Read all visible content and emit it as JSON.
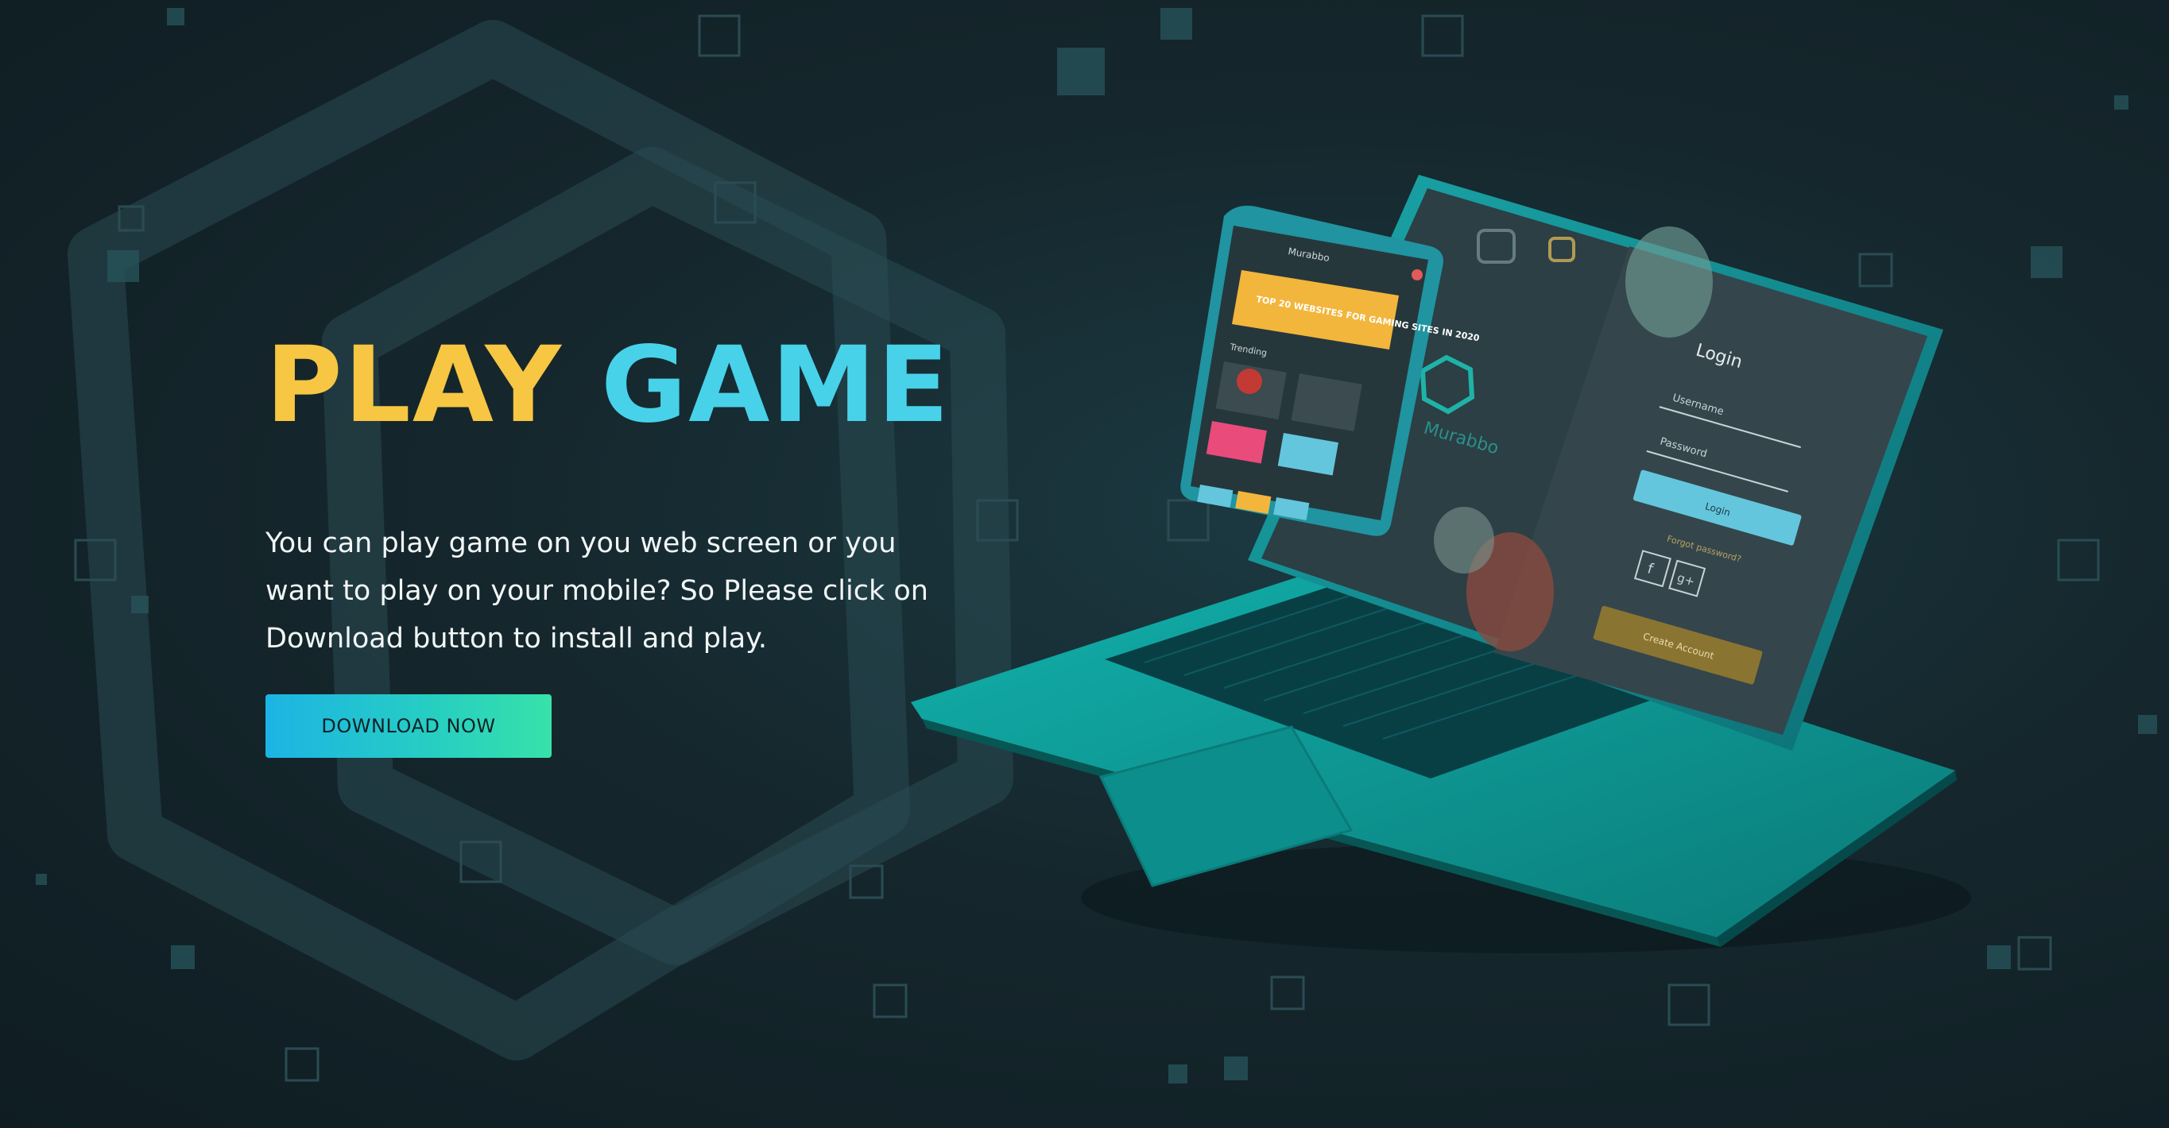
{
  "hero": {
    "title_word_1": "PLAY",
    "title_word_2": "GAME",
    "description": "You can play game on you web screen or you want to play on your mobile? So Please click on Download button to install and play.",
    "cta_label": "DOWNLOAD NOW"
  },
  "laptop_screen": {
    "brand": "Murabbo",
    "login_title": "Login",
    "username_placeholder": "Username",
    "password_placeholder": "Password",
    "login_button": "Login",
    "forgot_password": "Forgot password?",
    "create_account_button": "Create Account",
    "social_icons": [
      "facebook-icon",
      "google-plus-icon"
    ]
  },
  "phone_screen": {
    "brand": "Murabbo",
    "banner_text": "TOP 20 WEBSITES FOR GAMING SITES IN 2020",
    "section_label": "Trending"
  },
  "colors": {
    "background": "#15272d",
    "title_yellow": "#f7c642",
    "title_cyan": "#47d2ea",
    "laptop_body": "#0f9e9b",
    "cta_start": "#1cb4e4",
    "cta_end": "#37e2a9",
    "login_button": "#64c6dc",
    "create_account": "#8a7431"
  }
}
